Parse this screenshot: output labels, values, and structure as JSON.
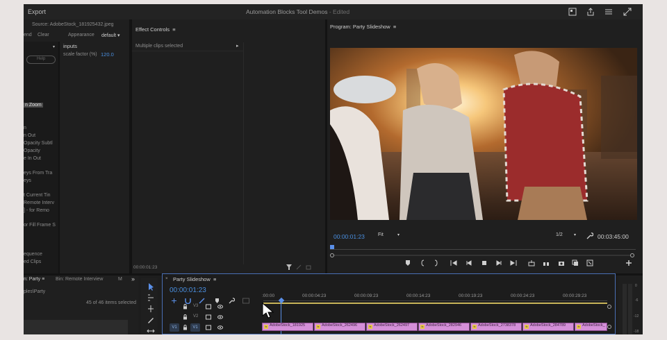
{
  "window": {
    "export_tab": "Export",
    "project_title": "Automation Blocks Tool Demos",
    "edited_suffix": " - Edited"
  },
  "source_panel": {
    "source_label": "Source: AdobeStock_181925432.jpeg",
    "tab_end": "end",
    "tab_clear": "Clear",
    "appearance_label": "Appearance",
    "appearance_value": "default",
    "inputs_header": "inputs",
    "scale_label": "scale factor (%)",
    "scale_value": "120.0",
    "help_button": "Help",
    "list_items": [
      "n Zoom",
      "n",
      "n Out",
      "Opacity Subtl",
      "Opacity",
      "e In Out",
      "eys From Tra",
      "eys",
      "t Current Tin",
      "Remote Interv",
      "] - for Remo",
      "or Fill Frame S",
      "equence",
      "ed Clips"
    ]
  },
  "effect_controls": {
    "title": "Effect Controls",
    "message": "Multiple clips selected",
    "timecode": "00:00:01:23"
  },
  "program_monitor": {
    "title": "Program: Party Slideshow",
    "timecode": "00:00:01:23",
    "fit_value": "Fit",
    "resolution": "1/2",
    "duration": "00:03:45:00"
  },
  "project_panel": {
    "tab_party": "n: Party",
    "tab_bin": "Bin: Remote Interview",
    "tab_more": "M",
    "path": "ples\\Party",
    "selection_count": "45 of 46 items selected"
  },
  "timeline": {
    "title": "Party Slideshow",
    "timecode": "00:00:01:23",
    "ruler": [
      ":00:00",
      "00:00:04:23",
      "00:00:09:23",
      "00:00:14:23",
      "00:00:19:23",
      "00:00:24:23",
      "00:00:29:23"
    ],
    "tracks": [
      "V3",
      "V2",
      "V1"
    ],
    "source_patch": "V1",
    "clips": [
      "AdobeStock_181925",
      "AdobeStock_262496",
      "AdobeStock_262497",
      "AdobeStock_282946",
      "AdobeStock_2738378",
      "AdobeStock_284789",
      "AdobeStock_"
    ],
    "clip_fx_label": "fx"
  },
  "meter": {
    "labels": [
      "0",
      "-6",
      "-12",
      "-18"
    ]
  },
  "colors": {
    "accent_blue": "#4a8fe0",
    "clip_pink": "#d48fd8",
    "playhead_blue": "#5a8fe8"
  }
}
